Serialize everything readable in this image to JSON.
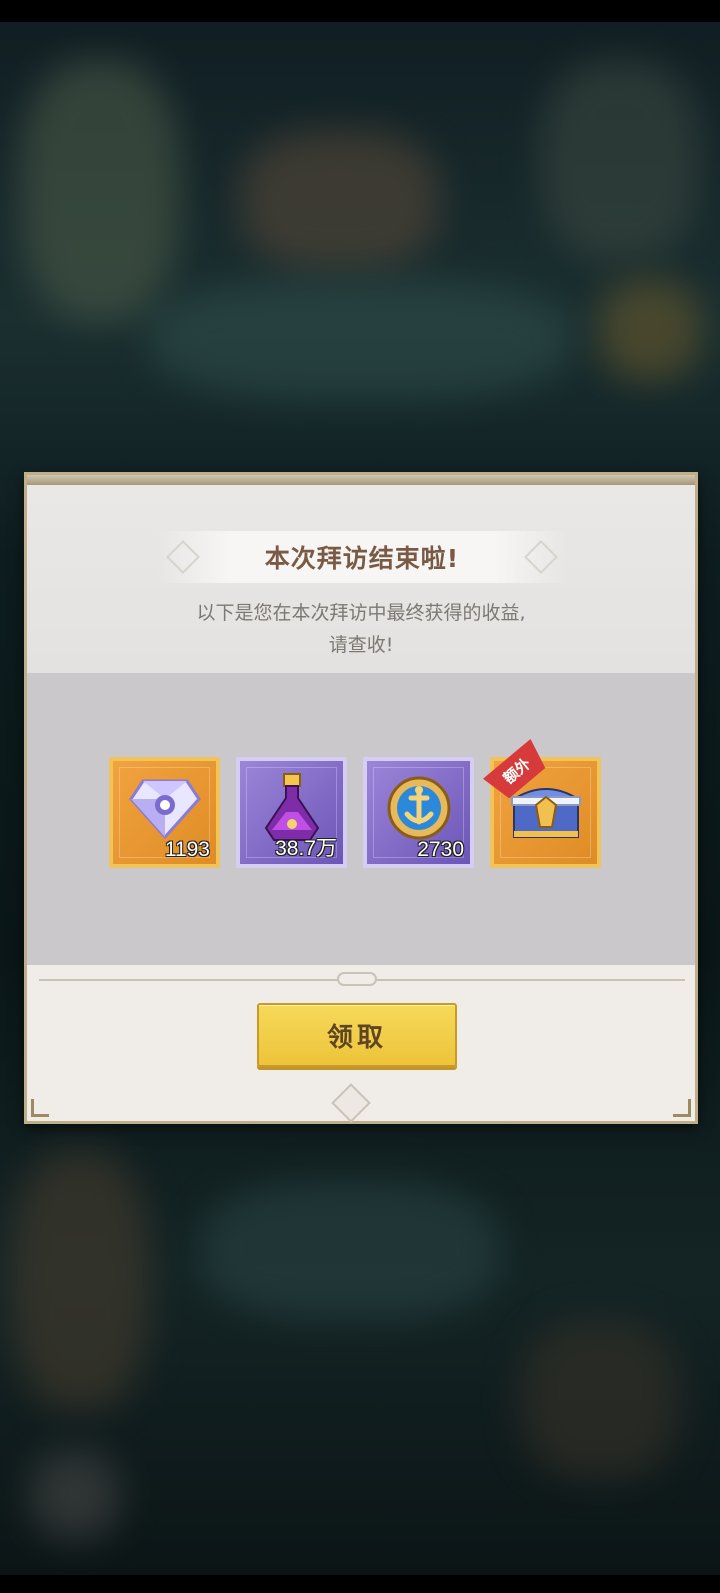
{
  "dialog": {
    "title": "本次拜访结束啦!",
    "subtitle_line1": "以下是您在本次拜访中最终获得的收益,",
    "subtitle_line2": "请查收!",
    "claim_label": "领取"
  },
  "rewards": [
    {
      "name": "diamond",
      "quantity": "1193",
      "frame": "orange"
    },
    {
      "name": "potion",
      "quantity": "38.7万",
      "frame": "purple"
    },
    {
      "name": "anchor-medal",
      "quantity": "2730",
      "frame": "purple"
    },
    {
      "name": "treasure-chest",
      "quantity": "",
      "frame": "orange",
      "tag": "额外"
    }
  ]
}
